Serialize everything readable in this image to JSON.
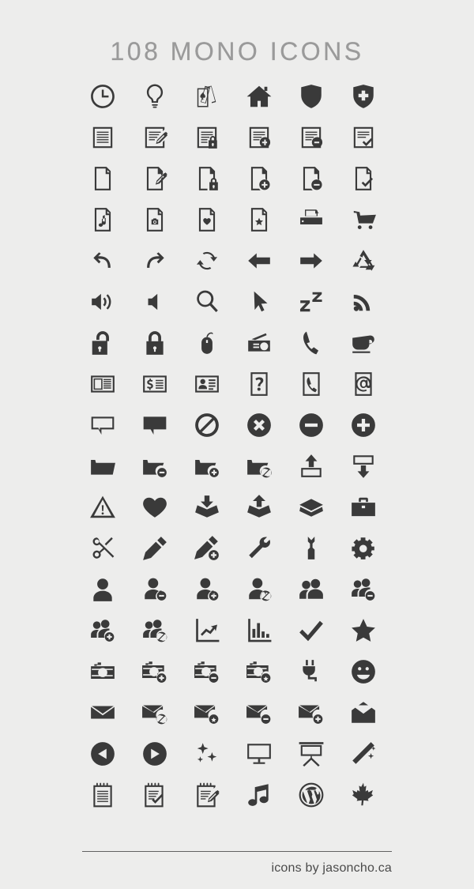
{
  "page": {
    "title": "108 MONO ICONS",
    "background_color": "#ededec",
    "icon_color": "#3a3a3a",
    "title_color": "#9a9a9a",
    "rule_color": "#616161"
  },
  "footer": {
    "credit": "icons by jasoncho.ca"
  },
  "grid": {
    "columns": 6,
    "rows": 18,
    "total_icons": 108
  },
  "icons": [
    {
      "name": "clock-icon",
      "label": "clock"
    },
    {
      "name": "lightbulb-icon",
      "label": "lightbulb"
    },
    {
      "name": "playing-cards-icon",
      "label": "playing cards"
    },
    {
      "name": "home-icon",
      "label": "home"
    },
    {
      "name": "shield-icon",
      "label": "shield"
    },
    {
      "name": "shield-plus-icon",
      "label": "shield plus"
    },
    {
      "name": "document-icon",
      "label": "document"
    },
    {
      "name": "document-edit-icon",
      "label": "document edit"
    },
    {
      "name": "document-lock-icon",
      "label": "document lock"
    },
    {
      "name": "document-add-icon",
      "label": "document add"
    },
    {
      "name": "document-remove-icon",
      "label": "document remove"
    },
    {
      "name": "document-check-icon",
      "label": "document check"
    },
    {
      "name": "file-icon",
      "label": "file"
    },
    {
      "name": "file-edit-icon",
      "label": "file edit"
    },
    {
      "name": "file-lock-icon",
      "label": "file lock"
    },
    {
      "name": "file-add-icon",
      "label": "file add"
    },
    {
      "name": "file-remove-icon",
      "label": "file remove"
    },
    {
      "name": "file-check-icon",
      "label": "file check"
    },
    {
      "name": "file-music-icon",
      "label": "file music"
    },
    {
      "name": "file-photo-icon",
      "label": "file photo"
    },
    {
      "name": "file-heart-icon",
      "label": "file heart"
    },
    {
      "name": "file-star-icon",
      "label": "file star"
    },
    {
      "name": "printer-icon",
      "label": "printer"
    },
    {
      "name": "shopping-cart-icon",
      "label": "shopping cart"
    },
    {
      "name": "undo-icon",
      "label": "undo"
    },
    {
      "name": "redo-icon",
      "label": "redo"
    },
    {
      "name": "refresh-icon",
      "label": "refresh"
    },
    {
      "name": "arrow-left-icon",
      "label": "arrow left"
    },
    {
      "name": "arrow-right-icon",
      "label": "arrow right"
    },
    {
      "name": "recycle-icon",
      "label": "recycle"
    },
    {
      "name": "volume-on-icon",
      "label": "volume on"
    },
    {
      "name": "volume-mute-icon",
      "label": "volume mute"
    },
    {
      "name": "search-icon",
      "label": "search"
    },
    {
      "name": "cursor-icon",
      "label": "cursor"
    },
    {
      "name": "sleep-icon",
      "label": "sleep"
    },
    {
      "name": "rss-icon",
      "label": "rss"
    },
    {
      "name": "unlock-icon",
      "label": "unlock"
    },
    {
      "name": "lock-icon",
      "label": "lock"
    },
    {
      "name": "mouse-icon",
      "label": "mouse"
    },
    {
      "name": "radio-icon",
      "label": "radio"
    },
    {
      "name": "phone-icon",
      "label": "phone"
    },
    {
      "name": "coffee-cup-icon",
      "label": "coffee cup"
    },
    {
      "name": "newspaper-icon",
      "label": "newspaper"
    },
    {
      "name": "invoice-icon",
      "label": "invoice"
    },
    {
      "name": "contact-card-icon",
      "label": "contact card"
    },
    {
      "name": "help-card-icon",
      "label": "help card"
    },
    {
      "name": "phone-card-icon",
      "label": "phone card"
    },
    {
      "name": "email-card-icon",
      "label": "email card"
    },
    {
      "name": "speech-bubble-outline-icon",
      "label": "speech bubble outline"
    },
    {
      "name": "speech-bubble-filled-icon",
      "label": "speech bubble filled"
    },
    {
      "name": "no-entry-icon",
      "label": "no entry"
    },
    {
      "name": "close-circle-icon",
      "label": "close circle"
    },
    {
      "name": "minus-circle-icon",
      "label": "minus circle"
    },
    {
      "name": "plus-circle-icon",
      "label": "plus circle"
    },
    {
      "name": "folder-icon",
      "label": "folder"
    },
    {
      "name": "folder-remove-icon",
      "label": "folder remove"
    },
    {
      "name": "folder-add-icon",
      "label": "folder add"
    },
    {
      "name": "folder-block-icon",
      "label": "folder block"
    },
    {
      "name": "upload-icon",
      "label": "upload"
    },
    {
      "name": "download-icon",
      "label": "download"
    },
    {
      "name": "warning-icon",
      "label": "warning"
    },
    {
      "name": "heart-icon",
      "label": "heart"
    },
    {
      "name": "inbox-icon",
      "label": "inbox"
    },
    {
      "name": "outbox-icon",
      "label": "outbox"
    },
    {
      "name": "box-icon",
      "label": "box"
    },
    {
      "name": "toolbox-icon",
      "label": "toolbox"
    },
    {
      "name": "scissors-icon",
      "label": "scissors"
    },
    {
      "name": "pencil-icon",
      "label": "pencil"
    },
    {
      "name": "pencil-add-icon",
      "label": "pencil add"
    },
    {
      "name": "wrench-icon",
      "label": "wrench"
    },
    {
      "name": "spanner-icon",
      "label": "spanner"
    },
    {
      "name": "gear-icon",
      "label": "gear"
    },
    {
      "name": "user-icon",
      "label": "user"
    },
    {
      "name": "user-remove-icon",
      "label": "user remove"
    },
    {
      "name": "user-add-icon",
      "label": "user add"
    },
    {
      "name": "user-block-icon",
      "label": "user block"
    },
    {
      "name": "users-icon",
      "label": "users"
    },
    {
      "name": "users-remove-icon",
      "label": "users remove"
    },
    {
      "name": "users-add-icon",
      "label": "users add"
    },
    {
      "name": "users-block-icon",
      "label": "users block"
    },
    {
      "name": "line-chart-icon",
      "label": "line chart"
    },
    {
      "name": "bar-chart-icon",
      "label": "bar chart"
    },
    {
      "name": "checkmark-icon",
      "label": "checkmark"
    },
    {
      "name": "star-icon",
      "label": "star"
    },
    {
      "name": "camera-icon",
      "label": "camera"
    },
    {
      "name": "camera-add-icon",
      "label": "camera add"
    },
    {
      "name": "camera-remove-icon",
      "label": "camera remove"
    },
    {
      "name": "camera-star-icon",
      "label": "camera star"
    },
    {
      "name": "plug-icon",
      "label": "plug"
    },
    {
      "name": "smiley-icon",
      "label": "smiley"
    },
    {
      "name": "mail-icon",
      "label": "mail"
    },
    {
      "name": "mail-block-icon",
      "label": "mail block"
    },
    {
      "name": "mail-star-icon",
      "label": "mail star"
    },
    {
      "name": "mail-remove-icon",
      "label": "mail remove"
    },
    {
      "name": "mail-add-icon",
      "label": "mail add"
    },
    {
      "name": "mail-open-icon",
      "label": "mail open"
    },
    {
      "name": "play-back-circle-icon",
      "label": "play back circle"
    },
    {
      "name": "play-circle-icon",
      "label": "play circle"
    },
    {
      "name": "sparkles-icon",
      "label": "sparkles"
    },
    {
      "name": "monitor-icon",
      "label": "monitor"
    },
    {
      "name": "presentation-screen-icon",
      "label": "presentation screen"
    },
    {
      "name": "magic-wand-icon",
      "label": "magic wand"
    },
    {
      "name": "notepad-icon",
      "label": "notepad"
    },
    {
      "name": "notepad-check-icon",
      "label": "notepad check"
    },
    {
      "name": "notepad-edit-icon",
      "label": "notepad edit"
    },
    {
      "name": "music-note-icon",
      "label": "music note"
    },
    {
      "name": "wordpress-icon",
      "label": "wordpress"
    },
    {
      "name": "maple-leaf-icon",
      "label": "maple leaf"
    }
  ]
}
